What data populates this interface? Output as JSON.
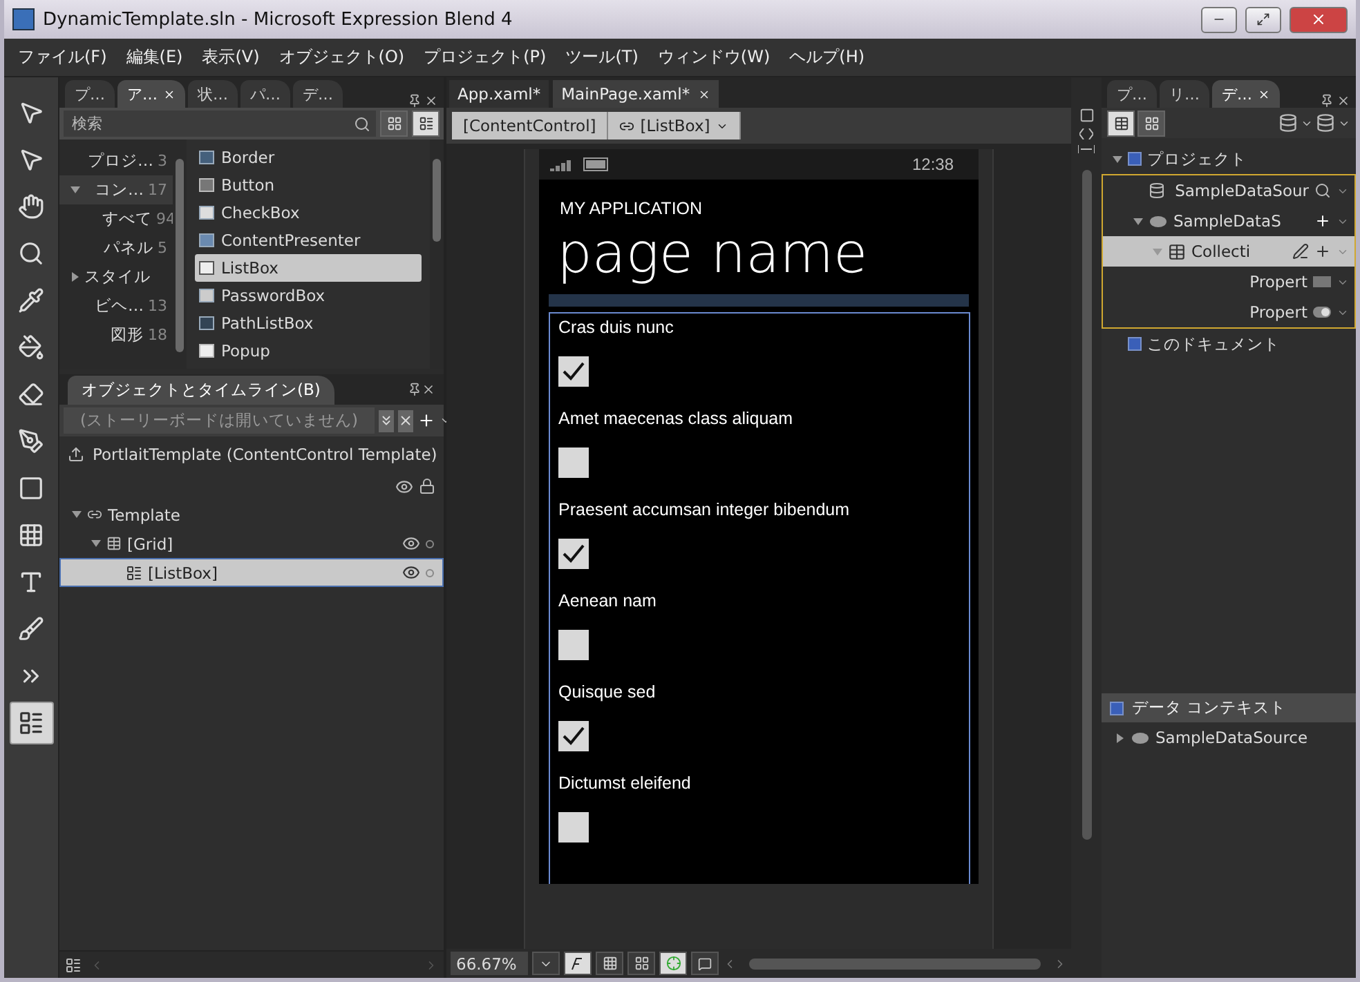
{
  "window": {
    "title": "DynamicTemplate.sln - Microsoft Expression Blend 4"
  },
  "menu": [
    "ファイル(F)",
    "編集(E)",
    "表示(V)",
    "オブジェクト(O)",
    "プロジェクト(P)",
    "ツール(T)",
    "ウィンドウ(W)",
    "ヘルプ(H)"
  ],
  "tools": [
    {
      "kind": "direct",
      "selected": false
    },
    {
      "kind": "select",
      "selected": false
    },
    {
      "kind": "pan",
      "selected": false
    },
    {
      "kind": "zoom",
      "selected": false
    },
    {
      "kind": "eyedropper",
      "selected": false
    },
    {
      "kind": "bucket",
      "selected": false
    },
    {
      "kind": "eraser",
      "selected": false
    },
    {
      "kind": "pen",
      "selected": false
    },
    {
      "kind": "rect",
      "selected": false
    },
    {
      "kind": "grid",
      "selected": false
    },
    {
      "kind": "text",
      "selected": false
    },
    {
      "kind": "brush",
      "selected": false
    },
    {
      "kind": "more",
      "selected": false
    },
    {
      "kind": "assets",
      "selected": true
    }
  ],
  "assets_panel": {
    "tabs": [
      {
        "label": "プ…",
        "selected": false
      },
      {
        "label": "ア…",
        "selected": true
      },
      {
        "label": "状…",
        "selected": false
      },
      {
        "label": "パ…",
        "selected": false
      },
      {
        "label": "デ…",
        "selected": false
      }
    ],
    "search": {
      "placeholder": "検索"
    },
    "categories": [
      {
        "label": "プロジ…",
        "count": "3",
        "selected": false
      },
      {
        "label": "コン…",
        "count": "17",
        "selected": true,
        "expanded": true,
        "children": [
          {
            "label": "すべて",
            "count": "94",
            "selected": false
          },
          {
            "label": "パネル",
            "count": "5",
            "selected": false
          }
        ]
      },
      {
        "label": "スタイル",
        "selected": false,
        "expanded": false
      },
      {
        "label": "ビヘ…",
        "count": "13",
        "selected": false
      },
      {
        "label": "図形",
        "count": "18",
        "selected": false
      }
    ],
    "items": [
      {
        "label": "Border",
        "kind": "border",
        "selected": false
      },
      {
        "label": "Button",
        "kind": "button",
        "selected": false
      },
      {
        "label": "CheckBox",
        "kind": "check",
        "selected": false
      },
      {
        "label": "ContentPresenter",
        "kind": "presenter",
        "selected": false
      },
      {
        "label": "ListBox",
        "kind": "list",
        "selected": true
      },
      {
        "label": "PasswordBox",
        "kind": "password",
        "selected": false
      },
      {
        "label": "PathListBox",
        "kind": "path",
        "selected": false
      },
      {
        "label": "Popup",
        "kind": "popup",
        "selected": false
      }
    ]
  },
  "objects_panel": {
    "title": "オブジェクトとタイムライン(B)",
    "storyboard": "(ストーリーボードは開いていません)",
    "root": "PortlaitTemplate (ContentControl Template)",
    "tree": [
      {
        "label": "Template",
        "kind": "template",
        "expanded": true,
        "selected": false,
        "children": [
          {
            "label": "[Grid]",
            "kind": "grid",
            "expanded": true,
            "selected": false,
            "children": [
              {
                "label": "[ListBox]",
                "kind": "list",
                "selected": true
              }
            ]
          }
        ]
      }
    ]
  },
  "documents": {
    "tabs": [
      {
        "label": "App.xaml*",
        "selected": false
      },
      {
        "label": "MainPage.xaml*",
        "selected": true
      }
    ],
    "breadcrumb": [
      "[ContentControl]",
      "[ListBox]"
    ]
  },
  "phone": {
    "time": "12:38",
    "app_title": "MY APPLICATION",
    "page_title": "page name",
    "items": [
      {
        "label": "Cras duis nunc",
        "checked": true
      },
      {
        "label": "Amet maecenas class aliquam",
        "checked": false
      },
      {
        "label": "Praesent accumsan integer bibendum",
        "checked": true
      },
      {
        "label": "Aenean nam",
        "checked": false
      },
      {
        "label": "Quisque sed",
        "checked": true
      },
      {
        "label": "Dictumst eleifend",
        "checked": false
      }
    ]
  },
  "zoom": "66.67%",
  "data_panel": {
    "tabs": [
      {
        "label": "プ…",
        "selected": false
      },
      {
        "label": "リ…",
        "selected": false
      },
      {
        "label": "デ…",
        "selected": true
      }
    ],
    "tree": [
      {
        "label": "プロジェクト",
        "kind": "scope",
        "expanded": true,
        "selected": false,
        "children": [
          {
            "label": "SampleDataSour",
            "kind": "source",
            "selected": false
          },
          {
            "label": "SampleDataS",
            "kind": "object",
            "expanded": true,
            "selected": false,
            "children": [
              {
                "label": "Collecti",
                "kind": "collection",
                "expanded": true,
                "selected": true,
                "children": [
                  {
                    "label": "Propert",
                    "kind": "text-prop",
                    "selected": false
                  },
                  {
                    "label": "Propert",
                    "kind": "bool-prop",
                    "selected": false
                  }
                ]
              }
            ]
          }
        ]
      },
      {
        "label": "このドキュメント",
        "kind": "scope",
        "selected": false
      }
    ],
    "context_title": "データ コンテキスト",
    "context": [
      {
        "label": "SampleDataSource",
        "expanded": false
      }
    ]
  }
}
